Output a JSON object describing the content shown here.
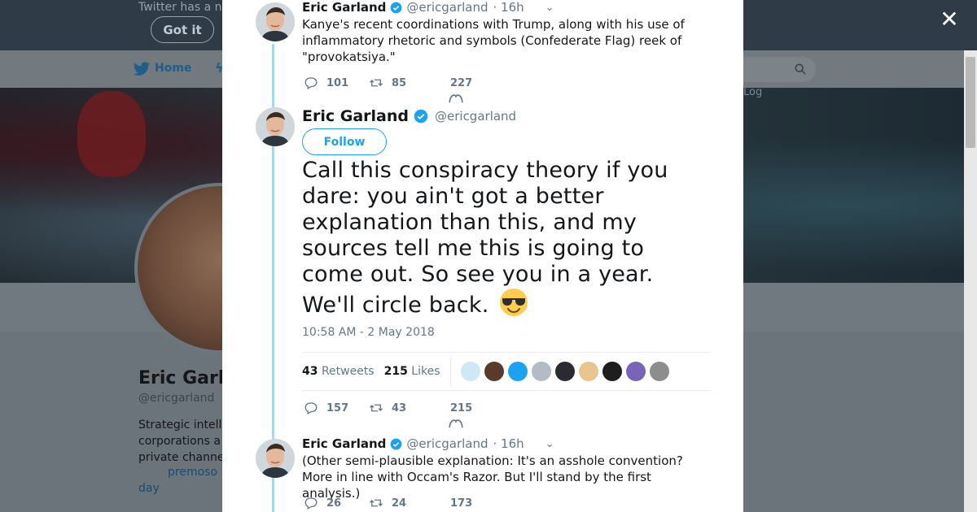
{
  "background": {
    "banner_text": "Twitter has a n",
    "got_it_label": "Got it",
    "nav_home_label": "Home",
    "login_text": "Log",
    "profile_name": "Eric Garla",
    "profile_handle": "@ericgarland",
    "bio_lines": [
      "Strategic intell",
      "corporations a",
      "private channe"
    ],
    "bio_link": "premoso",
    "bio_day": "day"
  },
  "modal": {
    "close_label": "✕",
    "tweets": [
      {
        "name": "Eric Garland",
        "handle": "@ericgarland",
        "time": "· 16h",
        "text": "Kanye's recent coordinations with Trump, along with his use of inflammatory rhetoric and symbols (Confederate Flag) reek of \"provokatsiya.\"",
        "replies": "101",
        "retweets": "85",
        "likes": "227"
      },
      {
        "name": "Eric Garland",
        "handle": "@ericgarland",
        "follow_label": "Follow",
        "text": "Call this conspiracy theory if you dare: you ain't got a better explanation than this, and my sources tell me this is going to come out. So see you in a year. We'll circle back.",
        "emoji": "smiling-face-with-sunglasses",
        "timestamp": "10:58 AM - 2 May 2018",
        "retweet_count": "43",
        "retweet_label": "Retweets",
        "like_count": "215",
        "like_label": "Likes",
        "replies": "157",
        "retweets": "43",
        "likes": "215"
      },
      {
        "name": "Eric Garland",
        "handle": "@ericgarland",
        "time": "· 16h",
        "text": "(Other semi-plausible explanation: It's an asshole convention? More in line with Occam's Razor. But I'll stand by the first analysis.)",
        "replies": "26",
        "retweets": "24",
        "likes": "173"
      }
    ],
    "likers": [
      {
        "color": "#cfe8f7",
        "icon": "anime-avatar"
      },
      {
        "color": "#5a3a2c",
        "icon": "woman-avatar"
      },
      {
        "color": "#1da1f2",
        "icon": "d-logo-avatar"
      },
      {
        "color": "#b3bcc4",
        "icon": "default-avatar"
      },
      {
        "color": "#2a2a33",
        "icon": "dark-avatar"
      },
      {
        "color": "#e9c48f",
        "icon": "dog-avatar"
      },
      {
        "color": "#1e1e1e",
        "icon": "badge-avatar"
      },
      {
        "color": "#7a64b8",
        "icon": "colorful-avatar"
      },
      {
        "color": "#8d8d8d",
        "icon": "gray-avatar"
      }
    ]
  },
  "colors": {
    "accent": "#1da1f2",
    "thread_line": "#a8d6f4",
    "secondary_text": "#657786",
    "primary_text": "#14171a"
  }
}
